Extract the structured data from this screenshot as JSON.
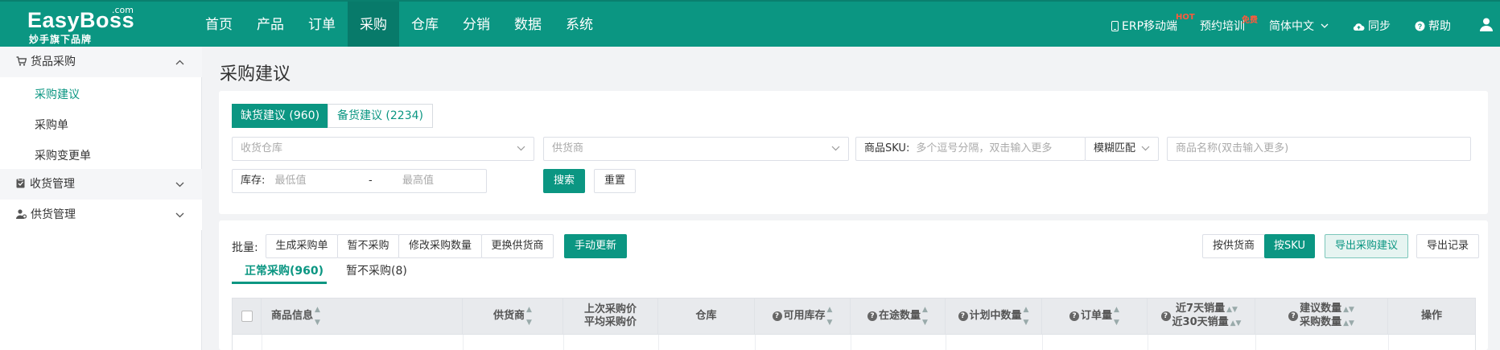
{
  "brand": {
    "name": "EasyBoss",
    "suffix": ".com",
    "tagline": "妙手旗下品牌"
  },
  "nav": [
    "首页",
    "产品",
    "订单",
    "采购",
    "仓库",
    "分销",
    "数据",
    "系统"
  ],
  "nav_active": "采购",
  "top_right": {
    "mobile": "ERP移动端",
    "mobile_badge": "HOT",
    "training": "预约培训",
    "training_badge": "免费",
    "language": "简体中文",
    "sync": "同步",
    "help": "帮助"
  },
  "sidebar": {
    "group1": "货品采购",
    "items": [
      "采购建议",
      "采购单",
      "采购变更单"
    ],
    "group2": "收货管理",
    "group3": "供货管理"
  },
  "page_title": "采购建议",
  "filter": {
    "tab_shortage": "缺货建议 (960)",
    "tab_stock": "备货建议 (2234)",
    "warehouse_placeholder": "收货仓库",
    "supplier_placeholder": "供货商",
    "sku_label": "商品SKU:",
    "sku_placeholder": "多个逗号分隔，双击输入更多",
    "match_mode": "模糊匹配",
    "name_placeholder": "商品名称(双击输入更多)",
    "stock_label": "库存:",
    "min_placeholder": "最低值",
    "range_sep": "-",
    "max_placeholder": "最高值",
    "search": "搜索",
    "reset": "重置"
  },
  "batch": {
    "label": "批量:",
    "buttons": [
      "生成采购单",
      "暂不采购",
      "修改采购数量",
      "更换供货商"
    ],
    "manual_update": "手动更新",
    "by_supplier": "按供货商",
    "by_sku": "按SKU",
    "export": "导出采购建议",
    "export_log": "导出记录"
  },
  "subtabs": {
    "normal": "正常采购(960)",
    "paused": "暂不采购(8)"
  },
  "columns": {
    "product": "商品信息",
    "supplier": "供货商",
    "last_price": "上次采购价",
    "avg_price": "平均采购价",
    "warehouse": "仓库",
    "available": "可用库存",
    "in_transit": "在途数量",
    "planned": "计划中数量",
    "orders": "订单量",
    "sales7": "近7天销量",
    "sales30": "近30天销量",
    "suggest_qty": "建议数量",
    "purchase_qty": "采购数量",
    "action": "操作"
  },
  "colors": {
    "primary": "#0b9682",
    "nav_active": "#087a6a",
    "badge": "#ff5a3c"
  }
}
